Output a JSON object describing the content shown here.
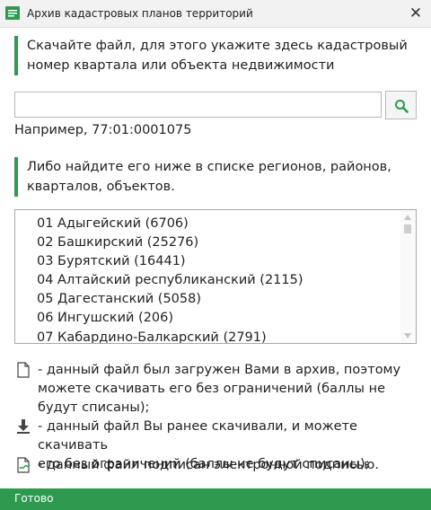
{
  "window": {
    "title": "Архив кадастровых планов территорий",
    "close_label": "✕"
  },
  "intro": {
    "line1": "Скачайте файл, для этого укажите здесь кадастровый",
    "line2": "номер квартала или объекта недвижимости"
  },
  "search": {
    "value": "",
    "placeholder": "",
    "example": "Например, 77:01:0001075",
    "button_icon": "search-icon"
  },
  "list_intro": {
    "line1": "Либо найдите его ниже в списке регионов, районов,",
    "line2": "кварталов, объектов."
  },
  "regions": [
    "01 Адыгейский (6706)",
    "02 Башкирский (25276)",
    "03 Бурятский (16441)",
    "04 Алтайский республиканский (2115)",
    "05 Дагестанский (5058)",
    "06 Ингушский (206)",
    "07 Кабардино-Балкарский (2791)"
  ],
  "legend": {
    "uploaded": {
      "icon": "document-icon",
      "line1": "- данный файл был загружен Вами в архив, поэтому",
      "line2": "можете скачивать его без ограничений (баллы не",
      "line3": "будут списаны);"
    },
    "downloaded": {
      "icon": "download-icon",
      "line1": "- данный файл Вы ранее скачивали, и можете скачивать",
      "line2": "его без ограничений (баллы не будут списаны);"
    },
    "signed": {
      "icon": "signed-document-icon",
      "line1": "- данный файл подписан электронной подписью."
    }
  },
  "status": {
    "text": "Готово"
  },
  "colors": {
    "accent": "#2e9a4f",
    "titlebar": "#f2f2f2",
    "border": "#a9a9a9"
  }
}
